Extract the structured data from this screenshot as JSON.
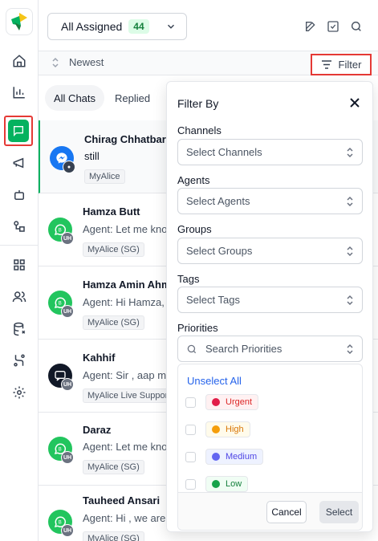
{
  "header": {
    "assigned_label": "All Assigned",
    "assigned_count": "44"
  },
  "sort": {
    "label": "Newest"
  },
  "filter_button": {
    "label": "Filter"
  },
  "tabs": [
    {
      "label": "All Chats",
      "active": true
    },
    {
      "label": "Replied",
      "active": false
    }
  ],
  "chats": [
    {
      "name": "Chirag Chhatbar",
      "message": "still",
      "source": "MyAlice",
      "channel": "messenger-icon",
      "selected": true
    },
    {
      "name": "Hamza Butt",
      "message": "Agent: Let me know",
      "source": "MyAlice (SG)",
      "channel": "whatsapp-icon",
      "badge": "UH"
    },
    {
      "name": "Hamza Amin Ahmed",
      "message": "Agent: Hi Hamza, sorry",
      "source": "MyAlice (SG)",
      "channel": "whatsapp-icon",
      "badge": "UH"
    },
    {
      "name": "Kahhif",
      "message": "Agent: Sir , aap mujhe",
      "source": "MyAlice Live Support",
      "channel": "livechat-icon",
      "badge": "UH"
    },
    {
      "name": "Daraz",
      "message": "Agent: Let me know",
      "source": "MyAlice (SG)",
      "channel": "whatsapp-icon",
      "badge": "UH"
    },
    {
      "name": "Tauheed Ansari",
      "message": "Agent: Hi , we are here",
      "source": "MyAlice (SG)",
      "channel": "whatsapp-icon",
      "badge": "UH"
    }
  ],
  "filter_panel": {
    "title": "Filter By",
    "sections": [
      {
        "label": "Channels",
        "placeholder": "Select Channels"
      },
      {
        "label": "Agents",
        "placeholder": "Select Agents"
      },
      {
        "label": "Groups",
        "placeholder": "Select Groups"
      },
      {
        "label": "Tags",
        "placeholder": "Select Tags"
      },
      {
        "label": "Priorities",
        "placeholder": "Search Priorities"
      }
    ],
    "unselect_all": "Unselect All",
    "priorities": [
      {
        "label": "Urgent",
        "color": "#e11d48",
        "text_color": "#dc2626",
        "bg": "#fff1f2"
      },
      {
        "label": "High",
        "color": "#f59e0b",
        "text_color": "#d97706",
        "bg": "#fffbeb"
      },
      {
        "label": "Medium",
        "color": "#6366f1",
        "text_color": "#4f46e5",
        "bg": "#eef2ff"
      },
      {
        "label": "Low",
        "color": "#16a34a",
        "text_color": "#15803d",
        "bg": "#f0fdf4"
      }
    ],
    "cancel_label": "Cancel",
    "select_label": "Select"
  },
  "colors": {
    "brand_green": "#04b25f",
    "highlight_red": "#e53935",
    "link_blue": "#2563eb"
  }
}
